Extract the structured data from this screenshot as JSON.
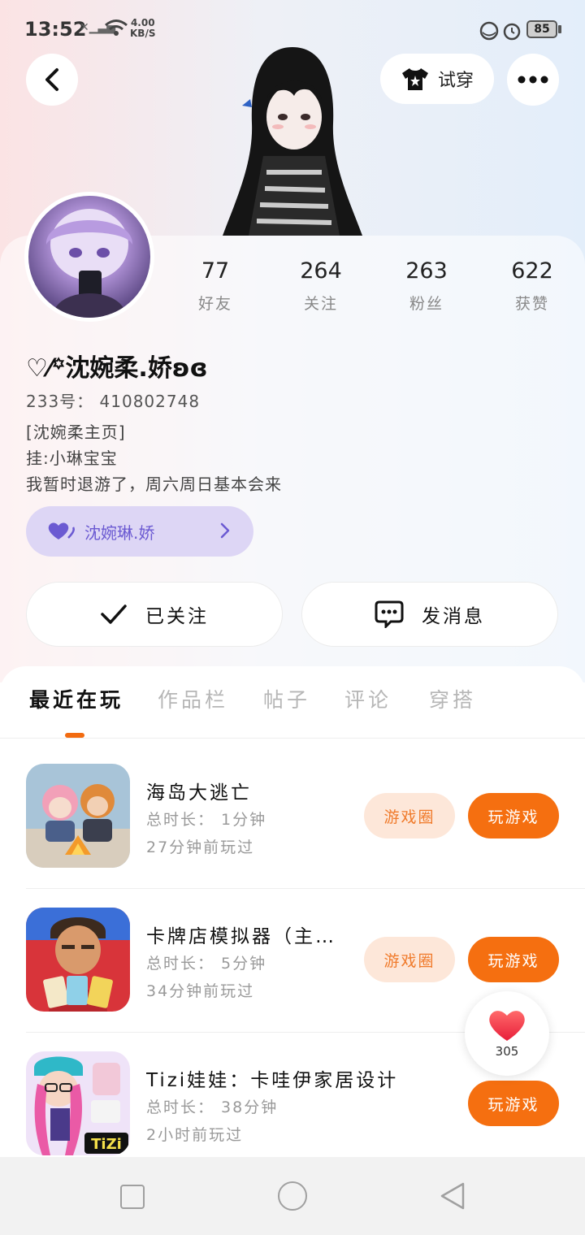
{
  "status_bar": {
    "time": "13:52",
    "network_speed_value": "4.00",
    "network_speed_unit": "KB/S",
    "battery": "85"
  },
  "header": {
    "tryon_label": "试穿"
  },
  "profile": {
    "stats": [
      {
        "value": "77",
        "label": "好友"
      },
      {
        "value": "264",
        "label": "关注"
      },
      {
        "value": "263",
        "label": "粉丝"
      },
      {
        "value": "622",
        "label": "获赞"
      }
    ],
    "nickname": "沈婉柔.娇",
    "uid": "233号： 410802748",
    "bio": [
      "[沈婉柔主页]",
      "挂:小琳宝宝",
      "我暂时退游了，周六周日基本会来"
    ],
    "cp_name": "沈婉琳.娇",
    "follow_label": "已关注",
    "message_label": "发消息"
  },
  "tabs": [
    "最近在玩",
    "作品栏",
    "帖子",
    "评论",
    "穿搭"
  ],
  "games": [
    {
      "title": "海岛大逃亡",
      "duration": "总时长： 1分钟",
      "last_played": "27分钟前玩过",
      "circle_label": "游戏圈",
      "play_label": "玩游戏",
      "icon": "island-escape-icon"
    },
    {
      "title": "卡牌店模拟器（主…",
      "duration": "总时长： 5分钟",
      "last_played": "34分钟前玩过",
      "circle_label": "游戏圈",
      "play_label": "玩游戏",
      "icon": "card-shop-icon"
    },
    {
      "title": "Tizi娃娃：卡哇伊家居设计",
      "duration": "总时长： 38分钟",
      "last_played": "2小时前玩过",
      "play_label": "玩游戏",
      "icon": "tizi-doll-icon",
      "icon_badge": "TiZi"
    }
  ],
  "like_float": {
    "count": "305"
  },
  "colors": {
    "accent": "#f56f10",
    "circle_bg": "#fde7d9",
    "cp_chip": "#ddd6f5"
  }
}
